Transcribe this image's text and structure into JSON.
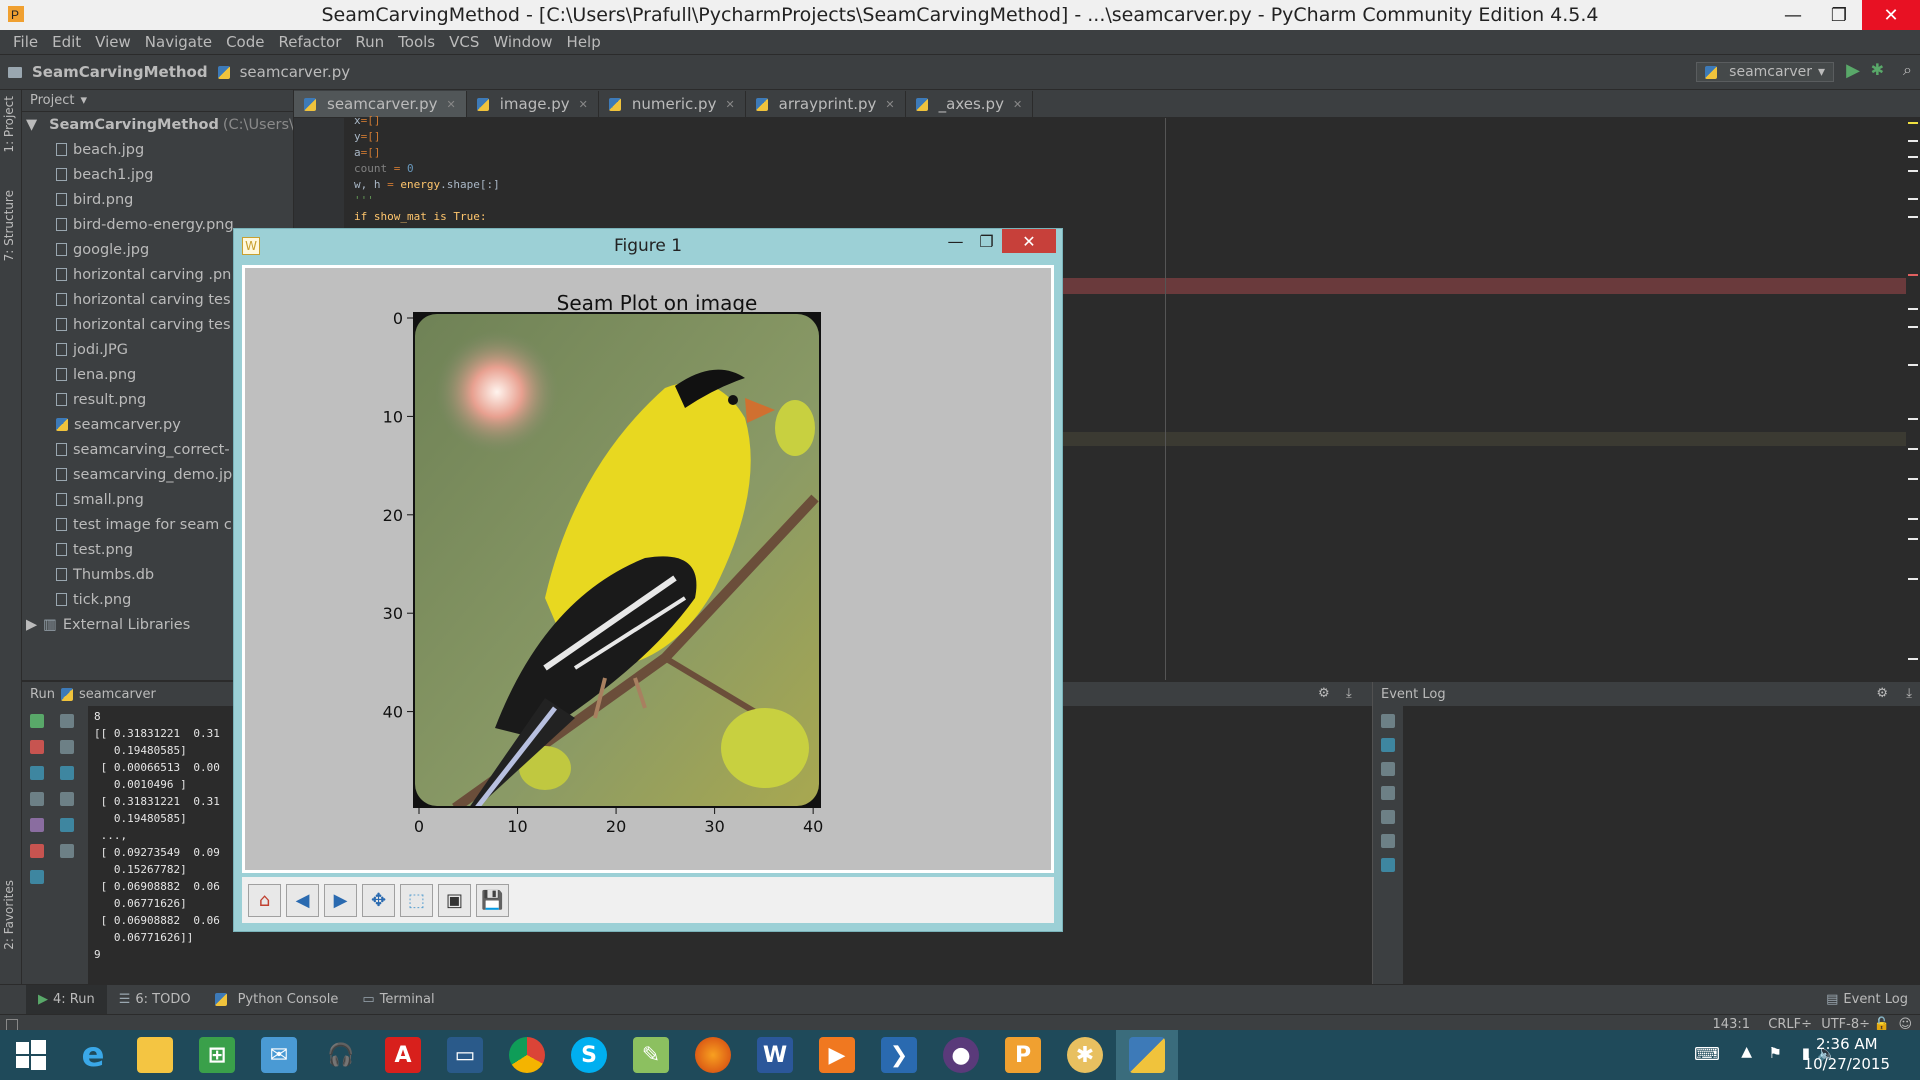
{
  "window": {
    "title": "SeamCarvingMethod - [C:\\Users\\Prafull\\PycharmProjects\\SeamCarvingMethod] - ...\\seamcarver.py - PyCharm Community Edition 4.5.4",
    "minimize": "—",
    "maximize": "❐",
    "close": "✕"
  },
  "menu": [
    "File",
    "Edit",
    "View",
    "Navigate",
    "Code",
    "Refactor",
    "Run",
    "Tools",
    "VCS",
    "Window",
    "Help"
  ],
  "nav": {
    "project": "SeamCarvingMethod",
    "file": "seamcarver.py",
    "run_config": "seamcarver"
  },
  "sidebar": {
    "project_tab": "1: Project",
    "structure_tab": "7: Structure",
    "favorites_tab": "2: Favorites"
  },
  "project_panel": {
    "header": "Project",
    "root": "SeamCarvingMethod",
    "root_path": "(C:\\Users\\Pr",
    "files": [
      "beach.jpg",
      "beach1.jpg",
      "bird.png",
      "bird-demo-energy.png",
      "google.jpg",
      "horizontal carving .pn",
      "horizontal carving tes",
      "horizontal carving tes",
      "jodi.JPG",
      "lena.png",
      "result.png",
      "seamcarver.py",
      "seamcarving_correct-",
      "seamcarving_demo.jp",
      "small.png",
      "test image for seam c",
      "test.png",
      "Thumbs.db",
      "tick.png"
    ],
    "external": "External Libraries"
  },
  "editor": {
    "tabs": [
      "seamcarver.py",
      "image.py",
      "numeric.py",
      "arrayprint.py",
      "_axes.py"
    ],
    "lines": [
      {
        "a": "x",
        "b": "=[]"
      },
      {
        "a": "y",
        "b": "=[]"
      },
      {
        "a": "a",
        "b": "=[]"
      },
      {
        "a": "count",
        "b": " = ",
        "c": "0"
      },
      {
        "a": "w, h ",
        "b": "= ",
        "c": "energy",
        "d": ".shape[:]"
      },
      {
        "a": "'''",
        "b": "",
        "c": "",
        "d": ""
      },
      {
        "a": "if show_mat is True:",
        "b": "",
        "c": "",
        "d": ""
      }
    ]
  },
  "run_panel": {
    "title": "Run",
    "config": "seamcarver",
    "output": [
      "8",
      "[[ 0.31831221  0.31",
      "   0.19480585]",
      " [ 0.00066513  0.00",
      "   0.0010496 ]",
      " [ 0.31831221  0.31",
      "   0.19480585]",
      " ...,",
      " [ 0.09273549  0.09",
      "   0.15267782]",
      " [ 0.06908882  0.06",
      "   0.06771626]",
      " [ 0.06908882  0.06",
      "   0.06771626]]",
      "9"
    ]
  },
  "event_log": {
    "title": "Event Log"
  },
  "toolstrip": {
    "run": "4: Run",
    "todo": "6: TODO",
    "python_console": "Python Console",
    "terminal": "Terminal",
    "event_log": "Event Log"
  },
  "status": {
    "position": "143:1",
    "line_sep": "CRLF÷",
    "encoding": "UTF-8÷"
  },
  "figure": {
    "window_title": "Figure 1",
    "chart_title": "Seam Plot on image",
    "minimize": "—",
    "maximize": "❐",
    "close": "✕"
  },
  "chart_data": {
    "type": "image",
    "title": "Seam Plot on image",
    "x_ticks": [
      "0",
      "10",
      "20",
      "30",
      "40"
    ],
    "y_ticks": [
      "0",
      "10",
      "20",
      "30",
      "40"
    ],
    "xlim": [
      0,
      41
    ],
    "ylim": [
      50,
      0
    ],
    "xlabel": "",
    "ylabel": "",
    "content": "goldfinch bird on branch"
  },
  "taskbar": {
    "apps": [
      "windows",
      "ie",
      "explorer",
      "store",
      "outlook",
      "headphones",
      "adobe",
      "remote",
      "chrome",
      "skype",
      "notepad",
      "firefox",
      "word",
      "media",
      "powershell",
      "github",
      "pycharm-ce",
      "paint",
      "python"
    ],
    "time": "2:36 AM",
    "date": "10/27/2015"
  },
  "colors": {
    "ide_bg": "#2b2b2b",
    "panel_bg": "#3c3f41",
    "error_line": "#6a3a3c",
    "taskbar": "#1f4a5a",
    "figure_frame": "#9cd0d6",
    "bird_yellow": "#e8d820"
  }
}
